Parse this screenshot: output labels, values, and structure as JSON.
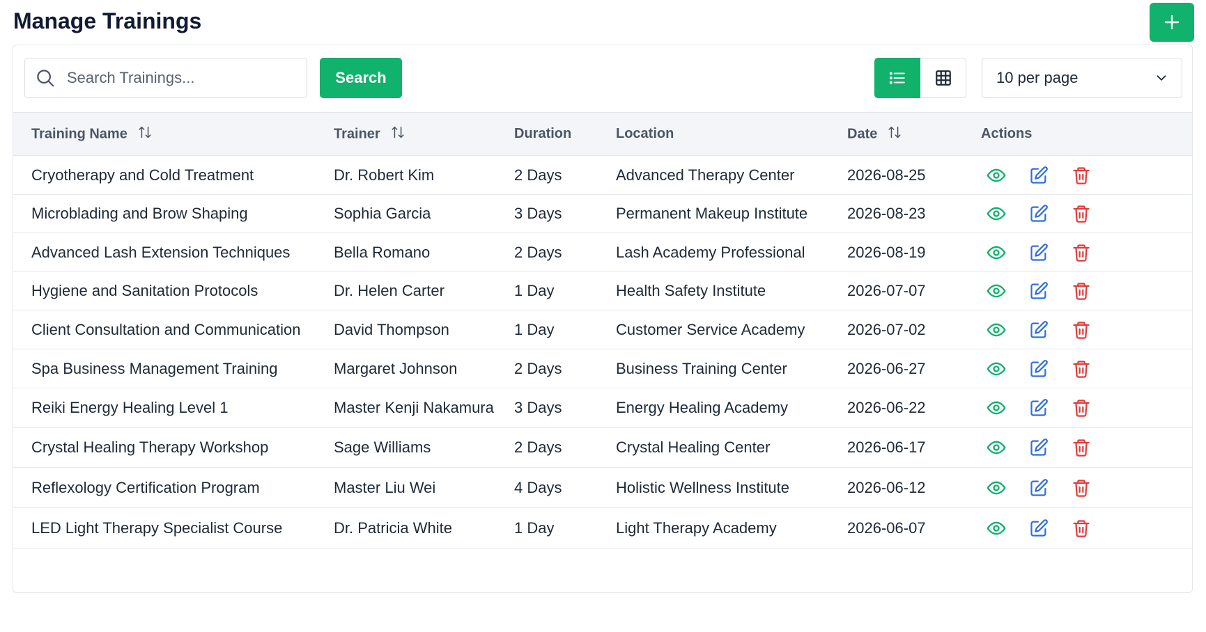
{
  "header": {
    "title": "Manage Trainings",
    "add_icon": "plus-icon"
  },
  "colors": {
    "accent": "#10b26c",
    "view": "#10b26c",
    "edit": "#2f6fde",
    "delete": "#e23b3b"
  },
  "toolbar": {
    "search_placeholder": "Search Trainings...",
    "search_label": "Search",
    "view_modes": [
      "list-view-icon",
      "grid-view-icon"
    ],
    "active_view": "list",
    "per_page_value": "10 per page"
  },
  "table": {
    "columns": [
      {
        "label": "Training Name",
        "sortable": true
      },
      {
        "label": "Trainer",
        "sortable": true
      },
      {
        "label": "Duration",
        "sortable": false
      },
      {
        "label": "Location",
        "sortable": false
      },
      {
        "label": "Date",
        "sortable": true
      },
      {
        "label": "Actions",
        "sortable": false
      }
    ],
    "rows": [
      {
        "name": "Cryotherapy and Cold Treatment",
        "trainer": "Dr. Robert Kim",
        "duration": "2 Days",
        "location": "Advanced Therapy Center",
        "date": "2026-08-25"
      },
      {
        "name": "Microblading and Brow Shaping",
        "trainer": "Sophia Garcia",
        "duration": "3 Days",
        "location": "Permanent Makeup Institute",
        "date": "2026-08-23"
      },
      {
        "name": "Advanced Lash Extension Techniques",
        "trainer": "Bella Romano",
        "duration": "2 Days",
        "location": "Lash Academy Professional",
        "date": "2026-08-19"
      },
      {
        "name": "Hygiene and Sanitation Protocols",
        "trainer": "Dr. Helen Carter",
        "duration": "1 Day",
        "location": "Health Safety Institute",
        "date": "2026-07-07"
      },
      {
        "name": "Client Consultation and Communication",
        "trainer": "David Thompson",
        "duration": "1 Day",
        "location": "Customer Service Academy",
        "date": "2026-07-02"
      },
      {
        "name": "Spa Business Management Training",
        "trainer": "Margaret Johnson",
        "duration": "2 Days",
        "location": "Business Training Center",
        "date": "2026-06-27"
      },
      {
        "name": "Reiki Energy Healing Level 1",
        "trainer": "Master Kenji Nakamura",
        "duration": "3 Days",
        "location": "Energy Healing Academy",
        "date": "2026-06-22"
      },
      {
        "name": "Crystal Healing Therapy Workshop",
        "trainer": "Sage Williams",
        "duration": "2 Days",
        "location": "Crystal Healing Center",
        "date": "2026-06-17"
      },
      {
        "name": "Reflexology Certification Program",
        "trainer": "Master Liu Wei",
        "duration": "4 Days",
        "location": "Holistic Wellness Institute",
        "date": "2026-06-12"
      },
      {
        "name": "LED Light Therapy Specialist Course",
        "trainer": "Dr. Patricia White",
        "duration": "1 Day",
        "location": "Light Therapy Academy",
        "date": "2026-06-07"
      }
    ],
    "row_actions": [
      "eye-icon",
      "edit-icon",
      "trash-icon"
    ]
  }
}
